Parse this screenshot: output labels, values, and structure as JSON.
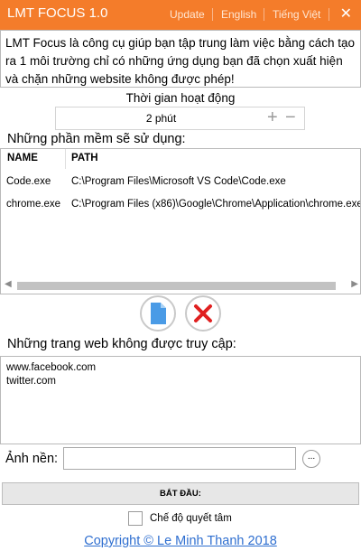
{
  "titlebar": {
    "title": "LMT FOCUS 1.0",
    "links": [
      "Update",
      "English",
      "Tiếng Việt"
    ],
    "close_glyph": "✕",
    "color": "#f47c2a"
  },
  "description": "LMT Focus là công cụ giúp bạn tập trung làm việc bằng cách tạo ra 1 môi trường chỉ có những ứng dụng bạn đã chọn xuất hiện và chặn những website không được phép!",
  "timer": {
    "label": "Thời gian hoạt động",
    "value": "2 phút",
    "plus_glyph": "+",
    "minus_glyph": "−"
  },
  "apps": {
    "label": "Những phần mềm sẽ sử dụng:",
    "columns": [
      "NAME",
      "PATH"
    ],
    "rows": [
      {
        "name": "Code.exe",
        "path": "C:\\Program Files\\Microsoft VS Code\\Code.exe"
      },
      {
        "name": "chrome.exe",
        "path": "C:\\Program Files (x86)\\Google\\Chrome\\Application\\chrome.exe"
      }
    ],
    "scroll_left_glyph": "◀",
    "scroll_right_glyph": "▶"
  },
  "buttons": {
    "add_icon": "file-icon",
    "remove_icon": "delete-x-icon"
  },
  "blocked": {
    "label": "Những trang web không được truy cập:",
    "sites": [
      "www.facebook.com",
      "twitter.com"
    ]
  },
  "background": {
    "label": "Ảnh nền:",
    "value": "",
    "browse_label": "..."
  },
  "start_label": "BẮT ĐẦU:",
  "strict_mode_label": "Chế độ quyết tâm",
  "copyright": "Copyright © Le Minh Thanh 2018"
}
